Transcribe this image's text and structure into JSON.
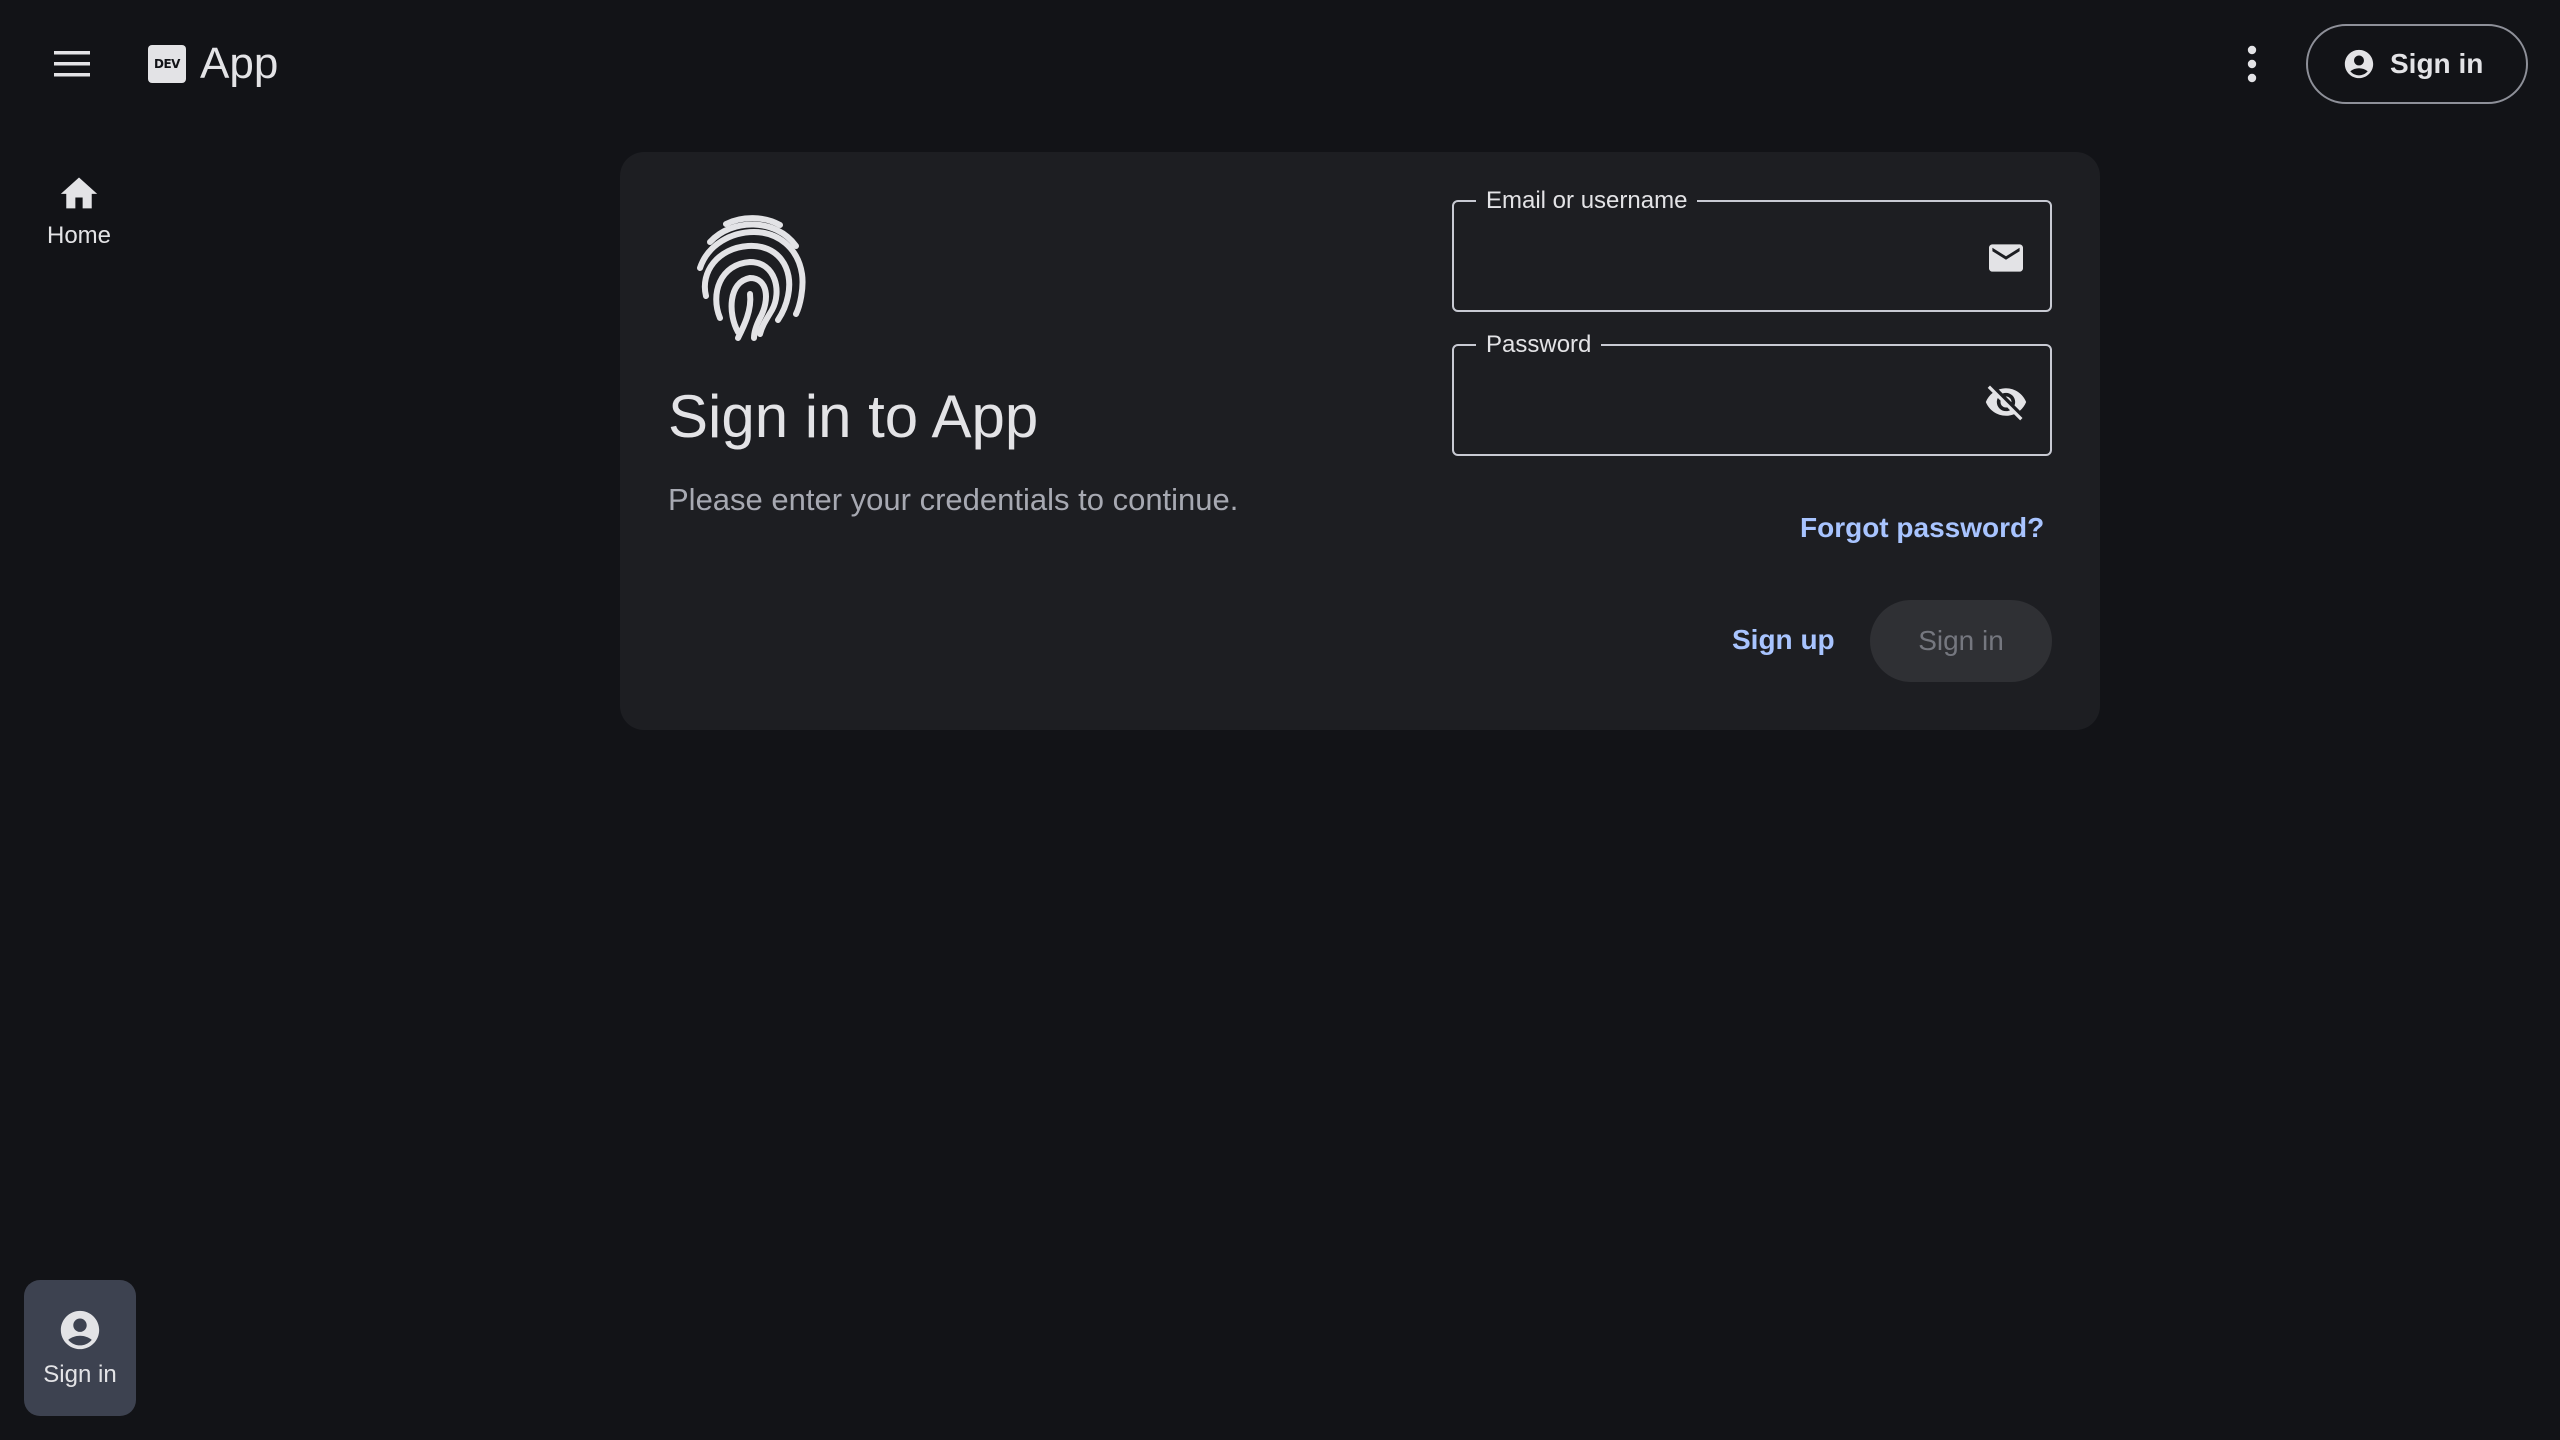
{
  "header": {
    "menu_icon": "hamburger-menu-icon",
    "badge_text": "DEV",
    "app_title": "App",
    "more_icon": "more-vert-icon",
    "signin_label": "Sign in",
    "signin_icon": "account-circle-icon"
  },
  "rail": {
    "home_label": "Home",
    "home_icon": "home-icon",
    "signin_label": "Sign in",
    "signin_icon": "account-circle-icon"
  },
  "card": {
    "logo_icon": "fingerprint-icon",
    "title": "Sign in to App",
    "subtitle": "Please enter your credentials to continue.",
    "email": {
      "label": "Email or username",
      "value": "",
      "icon": "mail-icon"
    },
    "password": {
      "label": "Password",
      "value": "",
      "icon": "visibility-off-icon"
    },
    "forgot_label": "Forgot password?",
    "signup_label": "Sign up",
    "signin_label": "Sign in"
  },
  "colors": {
    "background": "#121317",
    "card": "#1d1e22",
    "link": "#a8c4ff",
    "rail_active": "#3d4250",
    "disabled_button": "#2f3034"
  }
}
